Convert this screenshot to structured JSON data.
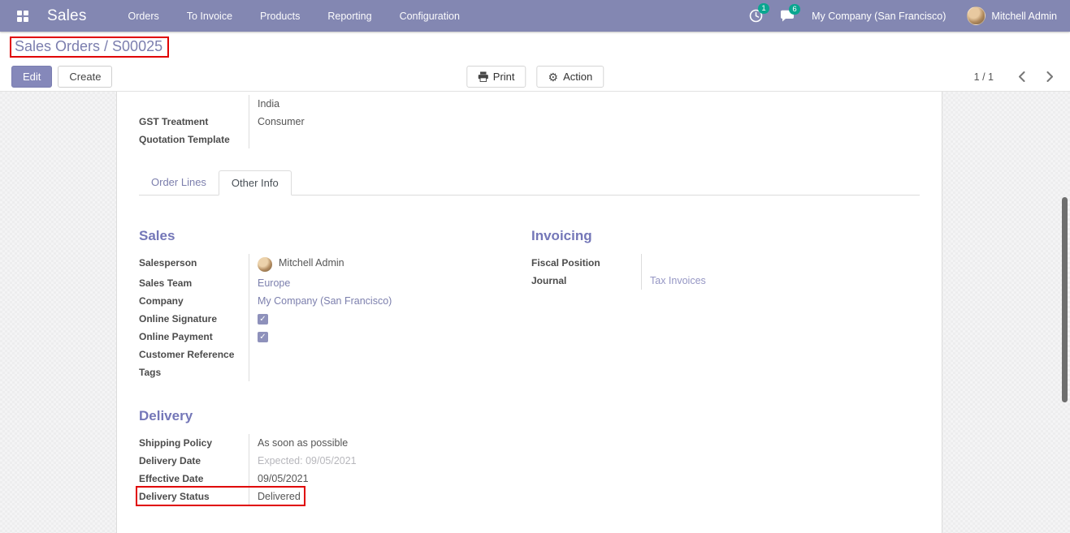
{
  "nav": {
    "brand": "Sales",
    "menus": [
      "Orders",
      "To Invoice",
      "Products",
      "Reporting",
      "Configuration"
    ],
    "activity_badge": "1",
    "message_badge": "6",
    "company": "My Company (San Francisco)",
    "user": "Mitchell Admin"
  },
  "control_panel": {
    "breadcrumb": "Sales Orders / S00025",
    "edit_label": "Edit",
    "create_label": "Create",
    "print_label": "Print",
    "action_label": "Action",
    "pager": "1 / 1"
  },
  "form_top": {
    "rows": [
      {
        "label": "",
        "value": "India"
      },
      {
        "label": "GST Treatment",
        "value": "Consumer"
      },
      {
        "label": "Quotation Template",
        "value": ""
      }
    ]
  },
  "tabs": {
    "order_lines": "Order Lines",
    "other_info": "Other Info"
  },
  "sections": {
    "sales": {
      "title": "Sales",
      "rows": [
        {
          "label": "Salesperson",
          "value": "Mitchell Admin"
        },
        {
          "label": "Sales Team",
          "value": "Europe"
        },
        {
          "label": "Company",
          "value": "My Company (San Francisco)"
        },
        {
          "label": "Online Signature",
          "checked": true
        },
        {
          "label": "Online Payment",
          "checked": true
        },
        {
          "label": "Customer Reference",
          "value": ""
        },
        {
          "label": "Tags",
          "value": ""
        }
      ]
    },
    "invoicing": {
      "title": "Invoicing",
      "rows": [
        {
          "label": "Fiscal Position",
          "value": ""
        },
        {
          "label": "Journal",
          "value": "Tax Invoices"
        }
      ]
    },
    "delivery": {
      "title": "Delivery",
      "rows": [
        {
          "label": "Shipping Policy",
          "value": "As soon as possible"
        },
        {
          "label": "Delivery Date",
          "value": "Expected: 09/05/2021"
        },
        {
          "label": "Effective Date",
          "value": "09/05/2021"
        },
        {
          "label": "Delivery Status",
          "value": "Delivered"
        }
      ]
    }
  },
  "glyphs": {
    "check": "✓",
    "gear": "⚙"
  },
  "colors": {
    "navbar": "#8387b2",
    "accent_link": "#7c7fad",
    "section_title": "#7477b8",
    "badge": "#0aa690",
    "annotation": "#e00000"
  }
}
